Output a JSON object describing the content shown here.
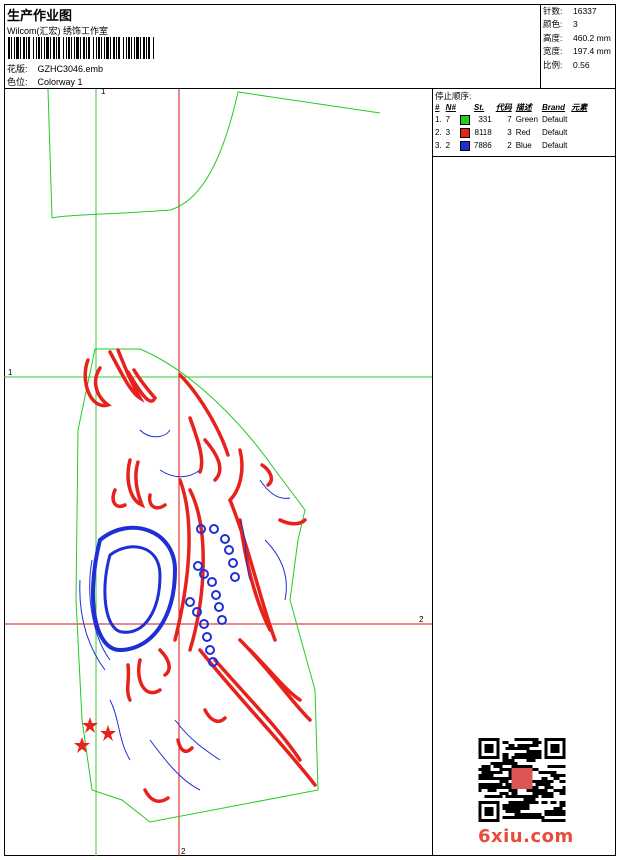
{
  "header": {
    "title": "生产作业图",
    "company": "Wilcom(汇宏) 绣饰工作室",
    "design_label": "花版:",
    "design_value": "GZHC3046.emb",
    "colorway_label": "色位:",
    "colorway_value": "Colorway 1"
  },
  "stats": [
    {
      "k": "针数:",
      "v": "16337"
    },
    {
      "k": "颜色:",
      "v": "3"
    },
    {
      "k": "高度:",
      "v": "460.2 mm"
    },
    {
      "k": "宽度:",
      "v": "197.4 mm"
    },
    {
      "k": "比例:",
      "v": "0.56"
    }
  ],
  "stop_sequence": {
    "title": "停止顺序:",
    "headers": [
      "#",
      "N#",
      "St.",
      "代码",
      "描述",
      "Brand",
      "元素"
    ],
    "rows": [
      {
        "idx": "1.",
        "n": "7",
        "color": "#22cc22",
        "st": "331",
        "code": "7",
        "desc": "Green",
        "brand": "Default"
      },
      {
        "idx": "2.",
        "n": "3",
        "color": "#e8211d",
        "st": "8118",
        "code": "3",
        "desc": "Red",
        "brand": "Default"
      },
      {
        "idx": "3.",
        "n": "2",
        "color": "#1e2fd6",
        "st": "7886",
        "code": "2",
        "desc": "Blue",
        "brand": "Default"
      }
    ]
  },
  "guides": {
    "v1": "1",
    "h1": "1",
    "h2": "2",
    "v2": "2"
  },
  "watermark": "6xiu.com",
  "colors": {
    "green": "#22cc22",
    "red": "#e8211d",
    "blue": "#1e2fd6",
    "guide_green": "#33cc33",
    "guide_red": "#dd1111"
  }
}
